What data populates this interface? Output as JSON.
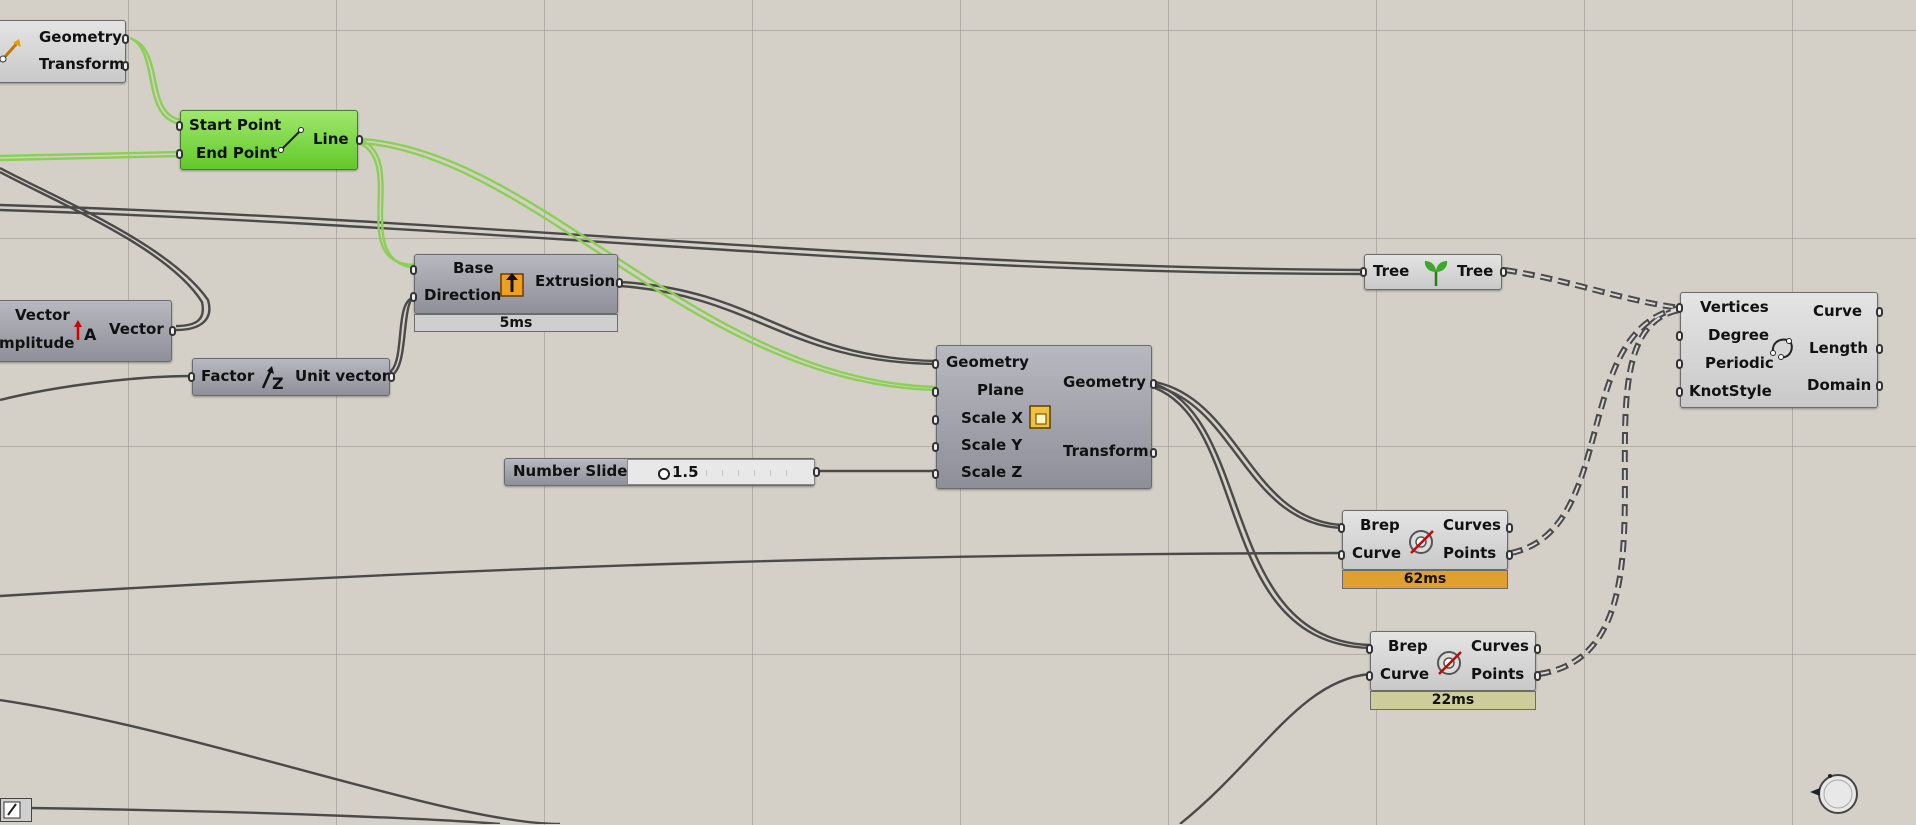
{
  "nodes": {
    "partial_left_top": {
      "outputs": [
        "Geometry",
        "Transform"
      ]
    },
    "line": {
      "inputs": [
        "Start Point",
        "End Point"
      ],
      "output": "Line"
    },
    "extrusion": {
      "inputs": [
        "Base",
        "Direction"
      ],
      "output": "Extrusion",
      "timer": "5ms"
    },
    "vector_amplitude": {
      "inputs": [
        "Vector",
        "mplitude"
      ],
      "output": "Vector"
    },
    "unit_vector": {
      "input": "Factor",
      "output": "Unit vector"
    },
    "scale_nu": {
      "inputs": [
        "Geometry",
        "Plane",
        "Scale X",
        "Scale Y",
        "Scale Z"
      ],
      "outputs": [
        "Geometry",
        "Transform"
      ]
    },
    "number_slider": {
      "label": "Number Slider",
      "value": "1.5",
      "fraction": 0.1
    },
    "tree": {
      "input": "Tree",
      "output": "Tree"
    },
    "nurbs_curve": {
      "inputs": [
        "Vertices",
        "Degree",
        "Periodic",
        "KnotStyle"
      ],
      "outputs": [
        "Curve",
        "Length",
        "Domain"
      ]
    },
    "brep_curve_1": {
      "inputs": [
        "Brep",
        "Curve"
      ],
      "outputs": [
        "Curves",
        "Points"
      ],
      "timer": "62ms"
    },
    "brep_curve_2": {
      "inputs": [
        "Brep",
        "Curve"
      ],
      "outputs": [
        "Curves",
        "Points"
      ],
      "timer": "22ms"
    }
  },
  "colors": {
    "canvas": "#d4d0c8",
    "wire": "#4a4a4a",
    "wire_selected": "#8ccf55",
    "component_selected": "#7ad842",
    "timer_slow": "#e0a030",
    "timer_mid": "#cdcd9c"
  },
  "icons": [
    "pivot-arrow-icon",
    "line-icon",
    "extrude-icon",
    "amplitude-icon",
    "unit-vector-icon",
    "scale-icon",
    "tree-sprout-icon",
    "nurbs-curve-icon",
    "brep-curve-intersect-icon",
    "navigation-compass-icon",
    "panel-toggle-icon"
  ]
}
